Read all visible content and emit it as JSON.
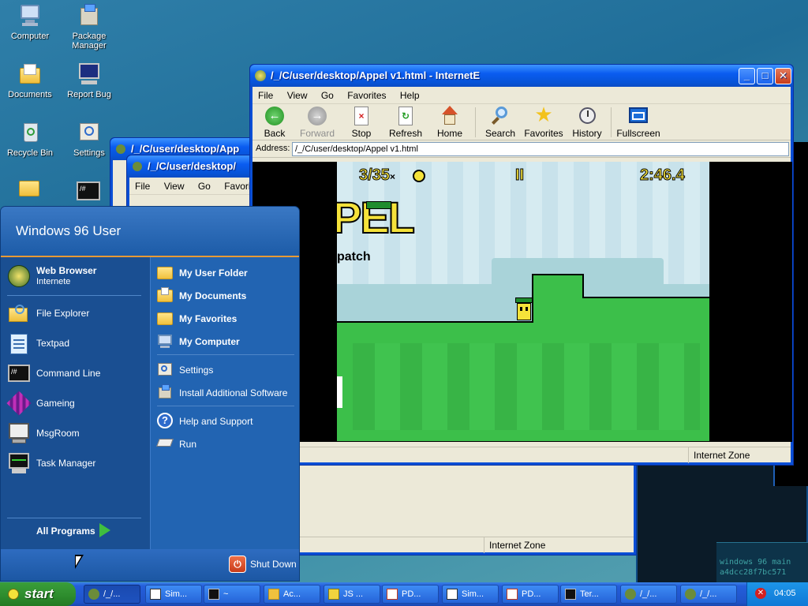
{
  "desktop": {
    "icons": [
      {
        "label": "Computer"
      },
      {
        "label": "Package Manager"
      },
      {
        "label": "Documents"
      },
      {
        "label": "Report Bug"
      },
      {
        "label": "Recycle Bin"
      },
      {
        "label": "Settings"
      }
    ],
    "terminal_text": [
      "windows 96 main",
      "a4dcc28f7bc571"
    ]
  },
  "back_window1": {
    "title": "/_/C/user/desktop/App",
    "status_zone": "Internet Zone"
  },
  "back_window2": {
    "title": "/_/C/user/desktop/",
    "menu": [
      "File",
      "View",
      "Go",
      "Favorites"
    ]
  },
  "browser": {
    "title": "/_/C/user/desktop/Appel v1.html - InternetE",
    "menu": [
      "File",
      "View",
      "Go",
      "Favorites",
      "Help"
    ],
    "toolbar": {
      "back": "Back",
      "forward": "Forward",
      "stop": "Stop",
      "refresh": "Refresh",
      "home": "Home",
      "search": "Search",
      "favorites": "Favorites",
      "history": "History",
      "fullscreen": "Fullscreen"
    },
    "address_label": "Address:",
    "address_value": "/_/C/user/desktop/Appel v1.html",
    "status_zone": "Internet Zone",
    "game": {
      "apples": "3/35",
      "apple_suffix": "×",
      "pause": "II",
      "timer": "2:46.4",
      "logo": "PEL",
      "subtitle": "patch"
    }
  },
  "start_menu": {
    "user": "Windows 96 User",
    "left_items": [
      {
        "label": "Web Browser",
        "sub": "Internete"
      },
      {
        "label": "File Explorer"
      },
      {
        "label": "Textpad"
      },
      {
        "label": "Command Line"
      },
      {
        "label": "Gameing"
      },
      {
        "label": "MsgRoom"
      },
      {
        "label": "Task Manager"
      }
    ],
    "right_items": [
      {
        "label": "My User Folder"
      },
      {
        "label": "My Documents"
      },
      {
        "label": "My Favorites"
      },
      {
        "label": "My Computer"
      },
      {
        "label": "Settings"
      },
      {
        "label": "Install Additional Software"
      },
      {
        "label": "Help and Support"
      },
      {
        "label": "Run"
      }
    ],
    "all_programs": "All Programs",
    "shutdown": "Shut Down"
  },
  "taskbar": {
    "start": "start",
    "tasks": [
      {
        "label": "/_/..."
      },
      {
        "label": "Sim..."
      },
      {
        "label": "~"
      },
      {
        "label": "Ac..."
      },
      {
        "label": "JS ..."
      },
      {
        "label": "PD..."
      },
      {
        "label": "Sim..."
      },
      {
        "label": "PD..."
      },
      {
        "label": "Ter..."
      },
      {
        "label": "/_/..."
      },
      {
        "label": "/_/..."
      }
    ],
    "clock": "04:05"
  }
}
